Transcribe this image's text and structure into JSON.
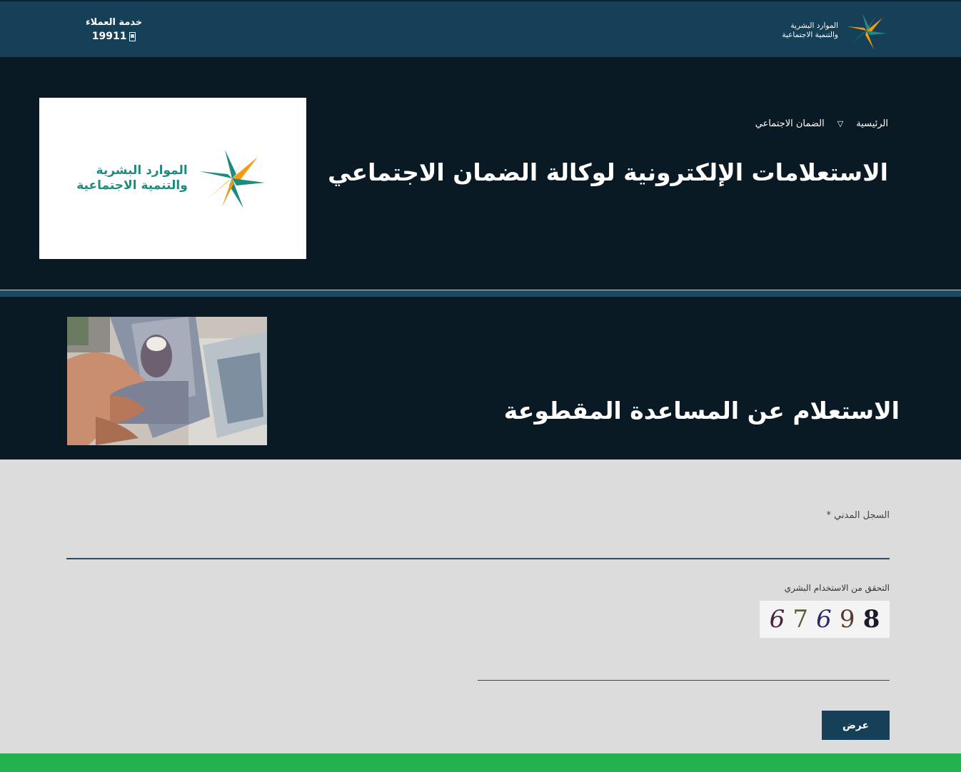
{
  "header": {
    "brand_line1": "الموارد البشرية",
    "brand_line2": "والتنمية الاجتماعية",
    "support_label": "خدمة العملاء",
    "support_number": "19911"
  },
  "hero": {
    "breadcrumb": [
      "الرئيسية",
      "الضمان الاجتماعي"
    ],
    "breadcrumb_separator": "▽",
    "title": "الاستعلامات الإلكترونية لوكالة الضمان الاجتماعي",
    "card_line1": "الموارد البشرية",
    "card_line2": "والتنمية الاجتماعية"
  },
  "section": {
    "title": "الاستعلام عن المساعدة المقطوعة"
  },
  "form": {
    "id_label": "السجل المدني *",
    "id_value": "",
    "captcha_label": "التحقق من الاستخدام البشري",
    "captcha_digits": [
      "6",
      "7",
      "6",
      "9",
      "8"
    ],
    "captcha_colors": [
      "#4a1f3f",
      "#5a5f3a",
      "#2a2a6a",
      "#5a3a2a",
      "#1a1a2a"
    ],
    "captcha_value": "",
    "submit_label": "عرض"
  },
  "colors": {
    "header_bg": "#163f58",
    "hero_bg": "#0a1a25",
    "form_bg": "#dcdcdc",
    "footer_green": "#23b14d",
    "logo_orange": "#f39c12",
    "logo_green": "#1f8a7f"
  },
  "icons": [
    "logo-star-icon",
    "phone-icon",
    "breadcrumb-chevron-icon"
  ]
}
